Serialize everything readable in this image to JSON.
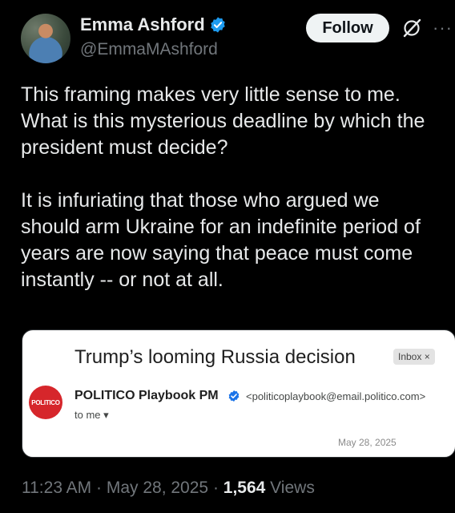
{
  "author": {
    "display_name": "Emma Ashford",
    "handle": "@EmmaMAshford",
    "verified": true
  },
  "actions": {
    "follow_label": "Follow",
    "grok_icon": "grok-icon",
    "more_icon": "more-icon"
  },
  "tweet": {
    "lines": [
      "This framing makes very little sense to me.",
      "What is this mysterious deadline by which the",
      "president must decide?",
      "",
      "It is infuriating that those who argued we",
      "should arm Ukraine for an indefinite period of",
      "years are now saying that peace must come",
      "instantly -- or not at all."
    ]
  },
  "email_card": {
    "subject": "Trump’s looming Russia decision",
    "badge": "Inbox ×",
    "sender_logo_text": "POLITICO",
    "sender_name": "POLITICO Playbook PM",
    "sender_email": "<politicoplaybook@email.politico.com>",
    "recipient": "to me ▾",
    "date": "May 28, 2025"
  },
  "meta": {
    "time": "11:23 AM",
    "date": "May 28, 2025",
    "separator": " · ",
    "views_count": "1,564",
    "views_label": " Views"
  },
  "colors": {
    "background": "#000000",
    "text": "#e7e9ea",
    "secondary": "#71767b",
    "verified_blue": "#1d9bf0",
    "politico_red": "#d6262b"
  }
}
